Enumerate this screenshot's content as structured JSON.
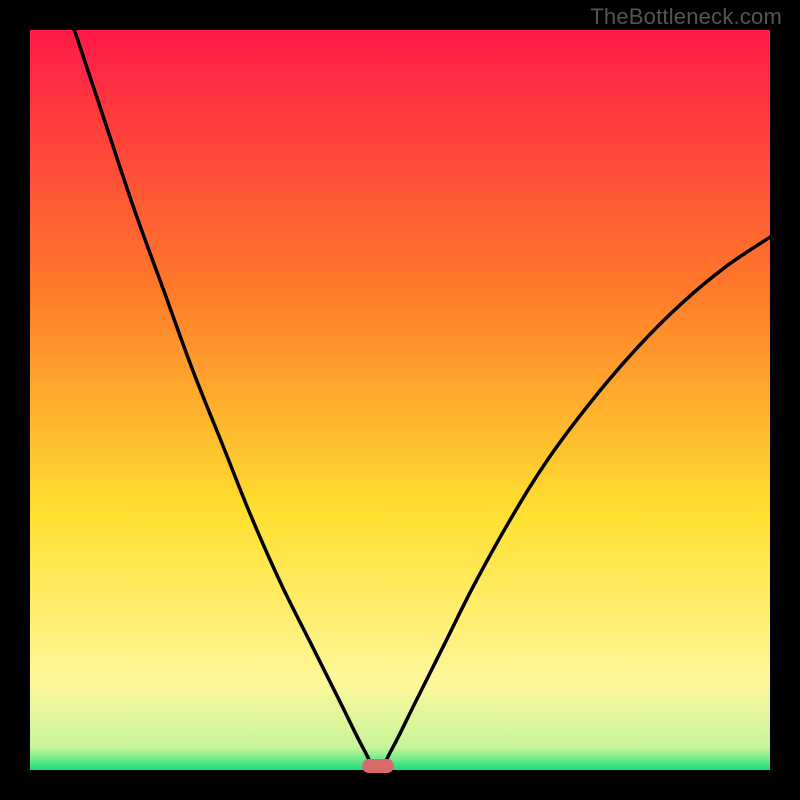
{
  "watermark": "TheBottleneck.com",
  "colors": {
    "bg": "#000000",
    "curve": "#000000",
    "marker": "#d86a6a",
    "gradient_top": "#ff1a48",
    "gradient_mid_upper": "#ff7a2a",
    "gradient_mid": "#ffdf2f",
    "gradient_mid_lower": "#fff79a",
    "gradient_bottom": "#18e07a"
  },
  "chart_data": {
    "type": "line",
    "title": "",
    "xlabel": "",
    "ylabel": "",
    "xlim": [
      0,
      100
    ],
    "ylim": [
      0,
      100
    ],
    "grid": false,
    "legend": false,
    "annotations": [],
    "marker": {
      "x": 47,
      "y": 0,
      "color": "#d86a6a"
    },
    "series": [
      {
        "name": "curve",
        "color": "#000000",
        "x": [
          6,
          10,
          14,
          18,
          22,
          26,
          30,
          34,
          38,
          42,
          45,
          47,
          49,
          52,
          56,
          60,
          65,
          70,
          76,
          82,
          88,
          94,
          100
        ],
        "y": [
          100,
          88,
          76,
          65,
          54,
          44,
          34,
          25,
          17,
          9,
          3,
          0,
          3,
          9,
          17,
          25,
          34,
          42,
          50,
          57,
          63,
          68,
          72
        ]
      }
    ],
    "background_gradient_stops": [
      {
        "offset": 0.0,
        "color": "#ff1a48"
      },
      {
        "offset": 0.35,
        "color": "#ff7a2a"
      },
      {
        "offset": 0.65,
        "color": "#ffdf2f"
      },
      {
        "offset": 0.88,
        "color": "#fff79a"
      },
      {
        "offset": 0.97,
        "color": "#c7f59a"
      },
      {
        "offset": 1.0,
        "color": "#18e07a"
      }
    ]
  }
}
